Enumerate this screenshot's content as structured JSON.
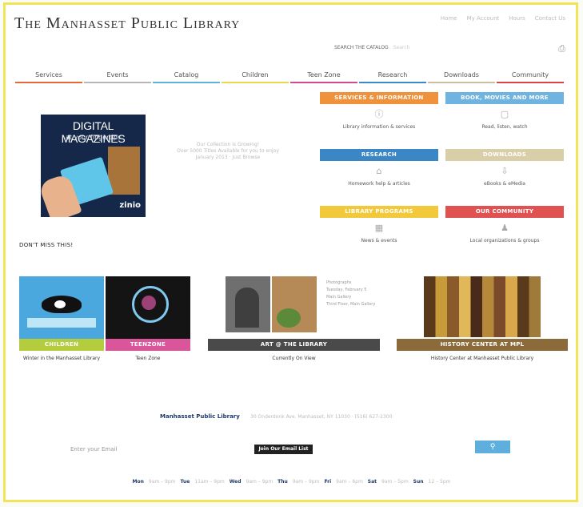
{
  "site": {
    "title": "The Manhasset Public Library",
    "top_links": [
      "Home",
      "My Account",
      "Hours",
      "Contact Us"
    ]
  },
  "search": {
    "label": "SEARCH THE CATALOG",
    "placeholder": "Search"
  },
  "nav": [
    {
      "label": "Services",
      "color": "#e8663a"
    },
    {
      "label": "Events",
      "color": "#b7b7b7"
    },
    {
      "label": "Catalog",
      "color": "#5ab3df"
    },
    {
      "label": "Children",
      "color": "#e7d94b"
    },
    {
      "label": "Teen Zone",
      "color": "#d44a92"
    },
    {
      "label": "Research",
      "color": "#3a89c9"
    },
    {
      "label": "Downloads",
      "color": "#c9c0a0"
    },
    {
      "label": "Community",
      "color": "#d84343"
    }
  ],
  "promo": {
    "title": "DIGITAL MAGAZINES",
    "subtitle": "at your fingertips",
    "brand": "zinio"
  },
  "notice": [
    "Our Collection is Growing!",
    "Over 5000 Titles Available for you to enjoy",
    "January 2013 · Just Browse"
  ],
  "dont_miss": "DON'T MISS THIS!",
  "categories": [
    {
      "title": "SERVICES & INFORMATION",
      "caption": "Library information & services",
      "color": "#f0913b",
      "icon": "info-icon",
      "glyph": "ⓘ"
    },
    {
      "title": "BOOK, MOVIES AND MORE",
      "caption": "Read, listen, watch",
      "color": "#6fb3e0",
      "icon": "book-icon",
      "glyph": "▢"
    },
    {
      "title": "RESEARCH",
      "caption": "Homework help & articles",
      "color": "#3b87c6",
      "icon": "research-icon",
      "glyph": "⌂"
    },
    {
      "title": "DOWNLOADS",
      "caption": "eBooks & eMedia",
      "color": "#d8cfa8",
      "icon": "download-icon",
      "glyph": "⇩"
    },
    {
      "title": "LIBRARY PROGRAMS",
      "caption": "News & events",
      "color": "#f2c93b",
      "icon": "calendar-icon",
      "glyph": "▦"
    },
    {
      "title": "OUR COMMUNITY",
      "caption": "Local organizations & groups",
      "color": "#e05252",
      "icon": "community-icon",
      "glyph": "♟"
    }
  ],
  "features": [
    {
      "label": "CHILDREN",
      "caption": "Winter in the Manhasset Library",
      "color": "#b5cc3e"
    },
    {
      "label": "TEENZONE",
      "caption": "Teen Zone",
      "color": "#d9569a"
    },
    {
      "label": "ART @ THE LIBRARY",
      "caption": "Currently On View",
      "color": "#4a4a4a",
      "art_text": [
        "Photographs",
        "Tuesday, February 5",
        "Main Gallery",
        "Third Floor, Main Gallery"
      ]
    },
    {
      "label": "HISTORY CENTER AT MPL",
      "caption": "History Center at Manhasset Public Library",
      "color": "#8c6b3a"
    }
  ],
  "footer": {
    "name": "Manhasset Public Library",
    "address": "30 Onderdonk Ave. Manhasset, NY 11030 · (516) 627-2300",
    "email_placeholder": "Enter your Email",
    "join_label": "Join Our Email List",
    "hours": [
      {
        "day": "Mon",
        "time": "9am – 9pm"
      },
      {
        "day": "Tue",
        "time": "11am – 9pm"
      },
      {
        "day": "Wed",
        "time": "9am – 9pm"
      },
      {
        "day": "Thu",
        "time": "9am – 9pm"
      },
      {
        "day": "Fri",
        "time": "9am – 6pm"
      },
      {
        "day": "Sat",
        "time": "9am – 5pm"
      },
      {
        "day": "Sun",
        "time": "12 – 5pm"
      }
    ]
  }
}
